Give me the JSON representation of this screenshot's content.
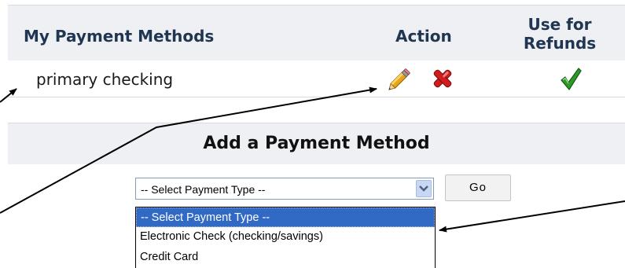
{
  "methods": {
    "header": {
      "name_col": "My Payment Methods",
      "action_col": "Action",
      "refunds_col_line1": "Use for",
      "refunds_col_line2": "Refunds"
    },
    "rows": [
      {
        "name": "primary checking",
        "actions": [
          "pencil-icon",
          "red-x-icon"
        ],
        "refund_status_icon": "green-checkmark-icon"
      }
    ]
  },
  "add_method": {
    "title": "Add a Payment Method",
    "select": {
      "selected": "-- Select Payment Type --",
      "options": [
        "-- Select Payment Type --",
        "Electronic Check (checking/savings)",
        "Credit Card"
      ]
    },
    "go_label": "Go"
  },
  "colors": {
    "header_bg": "#eef0f3",
    "header_text": "#1f3552",
    "selected_option_bg": "#316ac5",
    "delete_red": "#d01c1c",
    "check_green": "#2f9a2a"
  }
}
